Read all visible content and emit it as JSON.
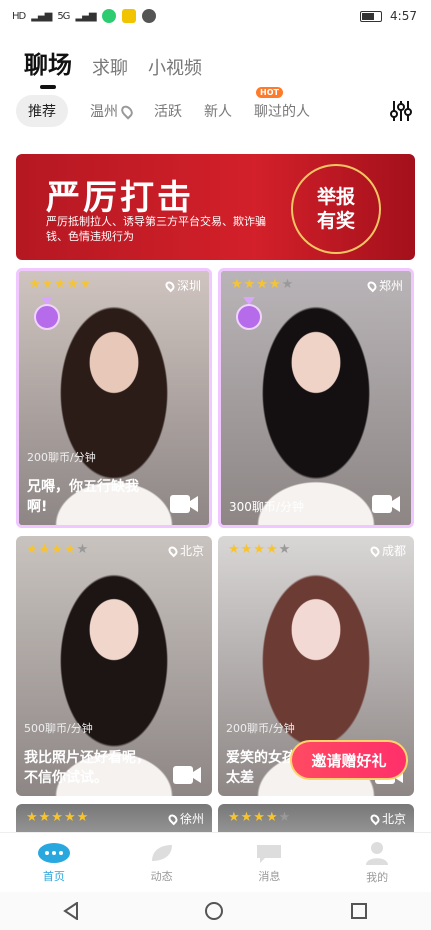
{
  "status": {
    "left_icons": [
      "sim-1",
      "sim-2",
      "signal",
      "signal",
      "wifi",
      "app-badge",
      "app-icon"
    ],
    "signal_label": "5G",
    "time": "4:57"
  },
  "tabs": [
    {
      "label": "聊场"
    },
    {
      "label": "求聊"
    },
    {
      "label": "小视频"
    }
  ],
  "filters": [
    {
      "label": "推荐"
    },
    {
      "label": "温州"
    },
    {
      "label": "活跃"
    },
    {
      "label": "新人"
    },
    {
      "label": "聊过的人",
      "badge": "HOT"
    }
  ],
  "banner": {
    "title": "严厉打击",
    "subtitle": "严厉抵制拉人、诱导第三方平台交易、欺诈骗钱、色情违规行为",
    "award": [
      "举报",
      "有奖"
    ]
  },
  "cards": [
    {
      "stars": 5,
      "city": "深圳",
      "price": "200聊币/分钟",
      "message": "兄嘚，你五行缺我啊!",
      "gold": true,
      "skin": "#e8c9b9",
      "hair": "#2b1c17",
      "bg": "#cfc4bf"
    },
    {
      "stars": 4,
      "city": "郑州",
      "price": "300聊币/分钟",
      "message": "",
      "gold": true,
      "skin": "#f0d3c7",
      "hair": "#141012",
      "bg": "#b9b4b7"
    },
    {
      "stars": 4,
      "city": "北京",
      "price": "500聊币/分钟",
      "message": "我比照片还好看呢，不信你试试。",
      "gold": false,
      "skin": "#f1d6cb",
      "hair": "#1c1514",
      "bg": "#c9c3bf"
    },
    {
      "stars": 4,
      "city": "成都",
      "price": "200聊币/分钟",
      "message": "爱笑的女孩运气不会太差",
      "gold": false,
      "skin": "#f3d9d3",
      "hair": "#6b3b34",
      "bg": "#d9d6d6"
    },
    {
      "stars": 5,
      "city": "徐州"
    },
    {
      "stars": 4,
      "city": "北京"
    }
  ],
  "invite": {
    "label": "邀请赠好礼"
  },
  "bottom_nav": [
    {
      "label": "首页",
      "icon": "chat-bubble-icon"
    },
    {
      "label": "动态",
      "icon": "leaf-icon"
    },
    {
      "label": "消息",
      "icon": "message-icon"
    },
    {
      "label": "我的",
      "icon": "person-icon"
    }
  ],
  "colors": {
    "accent": "#29a8e0",
    "banner": "#c8202a",
    "star": "#f7c431"
  }
}
